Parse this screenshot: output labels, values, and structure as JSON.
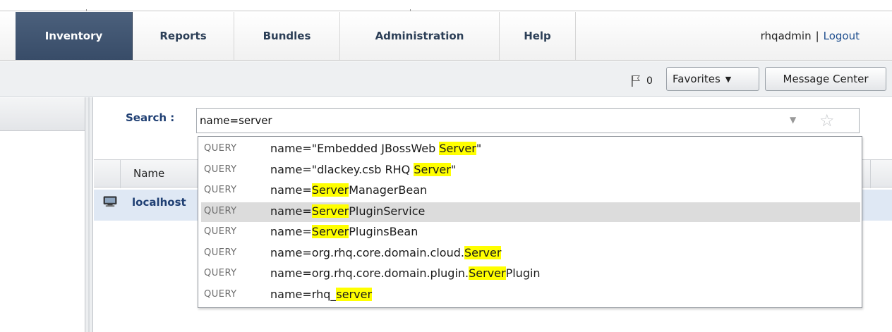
{
  "nav": {
    "tabs": [
      {
        "label": "Inventory",
        "active": true
      },
      {
        "label": "Reports",
        "active": false
      },
      {
        "label": "Bundles",
        "active": false
      },
      {
        "label": "Administration",
        "active": false
      },
      {
        "label": "Help",
        "active": false
      }
    ],
    "user": "rhqadmin",
    "separator": "|",
    "logout": "Logout"
  },
  "toolbar": {
    "flag_count": "0",
    "favorites_label": "Favorites",
    "message_center_label": "Message Center"
  },
  "search": {
    "label": "Search :",
    "value": "name=server"
  },
  "table": {
    "column_name": "Name",
    "rows": [
      {
        "name": "localhost",
        "icon": "computer-icon"
      }
    ]
  },
  "suggestions": [
    {
      "kind": "QUERY",
      "parts": [
        "name=\"Embedded JBossWeb ",
        "Server",
        "\""
      ],
      "highlighted": false
    },
    {
      "kind": "QUERY",
      "parts": [
        "name=\"dlackey.csb RHQ ",
        "Server",
        "\""
      ],
      "highlighted": false
    },
    {
      "kind": "QUERY",
      "parts": [
        "name=",
        "Server",
        "ManagerBean"
      ],
      "highlighted": false
    },
    {
      "kind": "QUERY",
      "parts": [
        "name=",
        "Server",
        "PluginService"
      ],
      "highlighted": true
    },
    {
      "kind": "QUERY",
      "parts": [
        "name=",
        "Server",
        "PluginsBean"
      ],
      "highlighted": false
    },
    {
      "kind": "QUERY",
      "parts": [
        "name=org.rhq.core.domain.cloud.",
        "Server",
        ""
      ],
      "highlighted": false
    },
    {
      "kind": "QUERY",
      "parts": [
        "name=org.rhq.core.domain.plugin.",
        "Server",
        "Plugin"
      ],
      "highlighted": false
    },
    {
      "kind": "QUERY",
      "parts": [
        "name=rhq_",
        "server",
        ""
      ],
      "highlighted": false
    }
  ],
  "colors": {
    "active_tab": "#415570",
    "match_highlight": "#ffff00",
    "link_blue": "#1f3f73",
    "selected_row": "#dfe8f4"
  }
}
